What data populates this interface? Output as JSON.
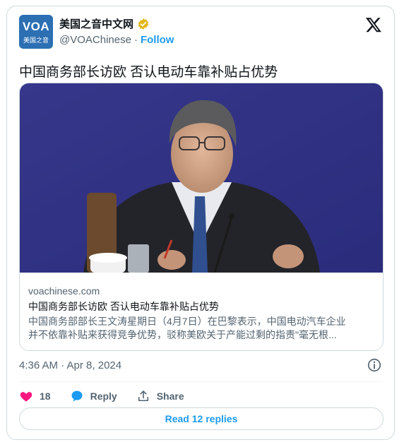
{
  "account": {
    "display_name": "美国之音中文网",
    "handle": "@VOAChinese",
    "separator": "·",
    "follow_label": "Follow",
    "avatar_text": "VOA",
    "avatar_subtext": "美国之音"
  },
  "tweet": {
    "text": "中国商务部长访欧 否认电动车靠补贴占优势"
  },
  "link_card": {
    "domain": "voachinese.com",
    "title": "中国商务部长访欧 否认电动车靠补贴占优势",
    "description_line1": "中国商务部部长王文涛星期日（4月7日）在巴黎表示，中国电动汽车企业",
    "description_line2": "并不依靠补贴来获得竞争优势，驳称美欧关于产能过剩的指责\"毫无根..."
  },
  "meta": {
    "timestamp": "4:36 AM · Apr 8, 2024"
  },
  "actions": {
    "like_count": "18",
    "reply_label": "Reply",
    "share_label": "Share"
  },
  "replies_button": "Read 12 replies",
  "colors": {
    "accent": "#1d9bf0",
    "like": "#f91880",
    "muted": "#536471",
    "avatar_bg": "#2c6fb3"
  },
  "icons": [
    "verified-badge-icon",
    "x-logo-icon",
    "info-icon",
    "heart-icon",
    "reply-bubble-icon",
    "share-icon"
  ]
}
